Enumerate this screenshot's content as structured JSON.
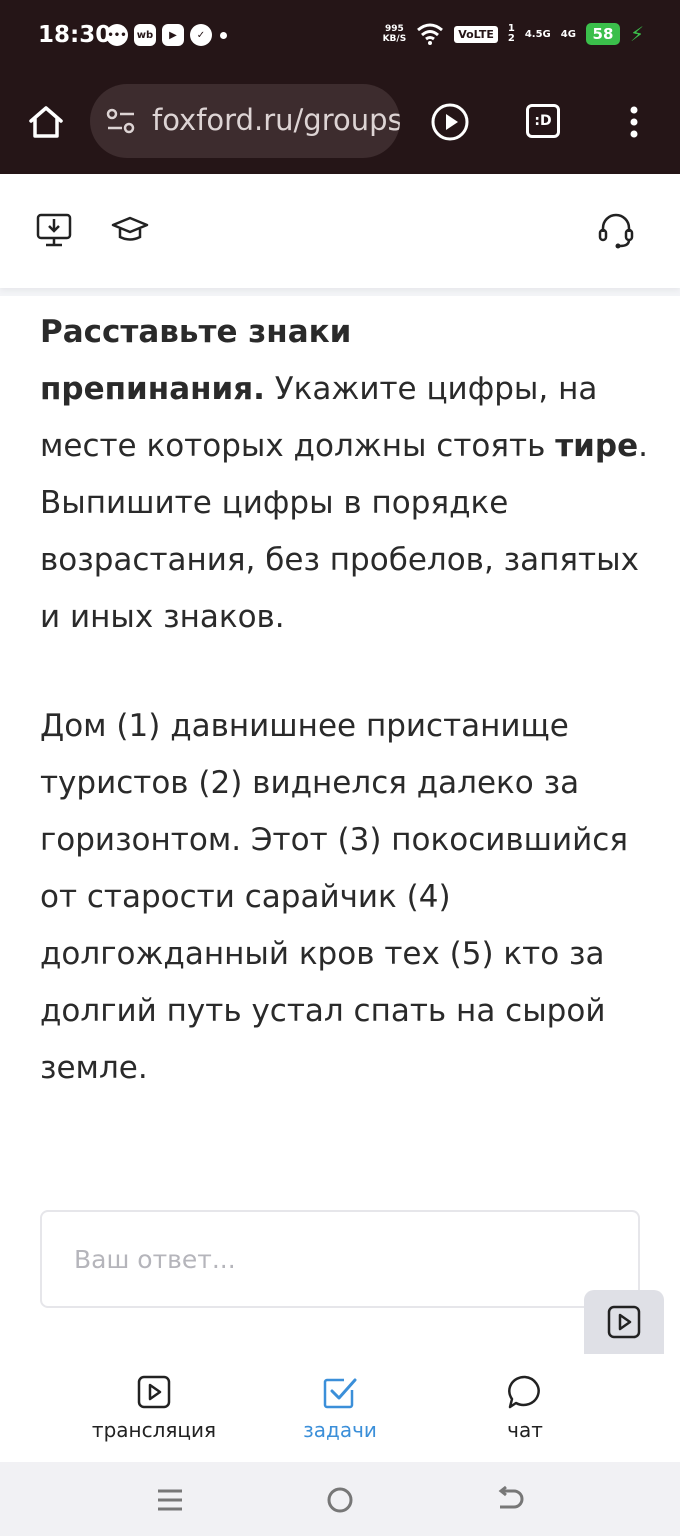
{
  "status_bar": {
    "time": "18:30",
    "speed_value": "995",
    "speed_unit": "KB/S",
    "volte": "VoLTE",
    "sim1": "1",
    "sim2": "2",
    "net1": "4.5G",
    "net2": "4G",
    "battery": "58"
  },
  "browser": {
    "url": "foxford.ru/groups",
    "d_badge": ":D"
  },
  "task": {
    "bold_lead_1": "Расставьте знаки",
    "bold_lead_2": "препинания.",
    "instruction_part1": " Укажите цифры, на месте которых должны стоять ",
    "bold_word": "тире",
    "instruction_part2": ". Выпишите цифры в порядке возрастания, без пробелов, запятых и иных знаков.",
    "sentence": "Дом (1) давнишнее пристанище туристов (2) виднелся далеко за горизонтом. Этот (3) покосившийся от старости сарайчик (4) долгожданный кров тех (5) кто за долгий путь устал спать на сырой земле."
  },
  "answer": {
    "value": "",
    "placeholder": "Ваш ответ..."
  },
  "bottom_nav": {
    "items": [
      {
        "label": "трансляция"
      },
      {
        "label": "задачи"
      },
      {
        "label": "чат"
      }
    ]
  },
  "colors": {
    "chrome_bg": "#251517",
    "accent": "#3b8fd9"
  }
}
